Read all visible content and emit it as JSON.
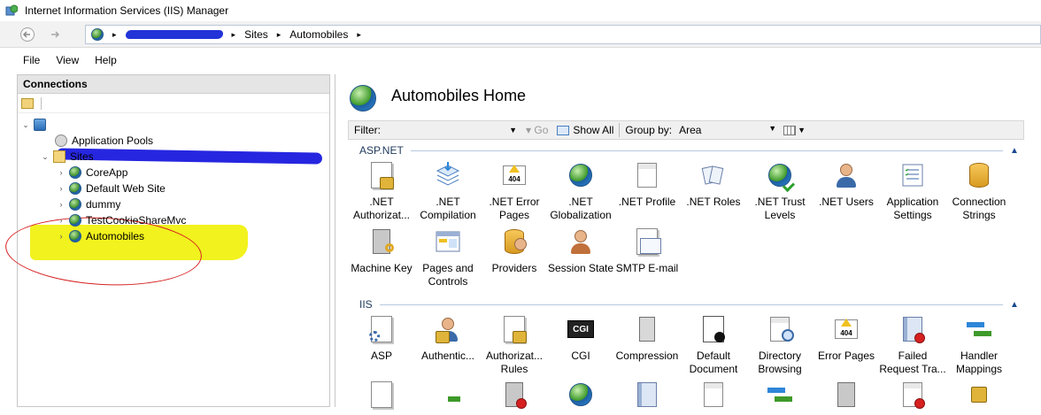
{
  "window": {
    "title": "Internet Information Services (IIS) Manager"
  },
  "address": {
    "segments": [
      "Sites",
      "Automobiles"
    ],
    "separator": "▸"
  },
  "menu": {
    "items": [
      "File",
      "View",
      "Help"
    ]
  },
  "connections": {
    "header": "Connections",
    "tree": [
      {
        "label": "Application Pools"
      },
      {
        "label": "Sites"
      },
      {
        "label": "CoreApp"
      },
      {
        "label": "Default Web Site"
      },
      {
        "label": "dummy"
      },
      {
        "label": "TestCookieShareMvc"
      },
      {
        "label": "Automobiles"
      }
    ]
  },
  "home": {
    "title": "Automobiles Home"
  },
  "filter": {
    "label": "Filter:",
    "go_label": "Go",
    "show_all_label": "Show All",
    "group_by_label": "Group by:",
    "group_by_value": "Area"
  },
  "sections": {
    "aspnet": {
      "name": "ASP.NET",
      "tiles": [
        {
          "label": ".NET\nAuthorizat..."
        },
        {
          "label": ".NET\nCompilation"
        },
        {
          "label": ".NET Error\nPages"
        },
        {
          "label": ".NET\nGlobalization"
        },
        {
          "label": ".NET Profile"
        },
        {
          "label": ".NET Roles"
        },
        {
          "label": ".NET Trust\nLevels"
        },
        {
          "label": ".NET Users"
        },
        {
          "label": "Application\nSettings"
        },
        {
          "label": "Connection\nStrings"
        },
        {
          "label": "Machine Key"
        },
        {
          "label": "Pages and\nControls"
        },
        {
          "label": "Providers"
        },
        {
          "label": "Session State"
        },
        {
          "label": "SMTP E-mail"
        }
      ]
    },
    "iis": {
      "name": "IIS",
      "tiles": [
        {
          "label": "ASP"
        },
        {
          "label": "Authentic..."
        },
        {
          "label": "Authorizat...\nRules"
        },
        {
          "label": "CGI",
          "icon_text": "CGI"
        },
        {
          "label": "Compression"
        },
        {
          "label": "Default\nDocument"
        },
        {
          "label": "Directory\nBrowsing"
        },
        {
          "label": "Error Pages"
        },
        {
          "label": "Failed\nRequest Tra..."
        },
        {
          "label": "Handler\nMappings"
        }
      ]
    }
  },
  "icons": {
    "warning_code": "404",
    "cgi_text": "CGI"
  }
}
